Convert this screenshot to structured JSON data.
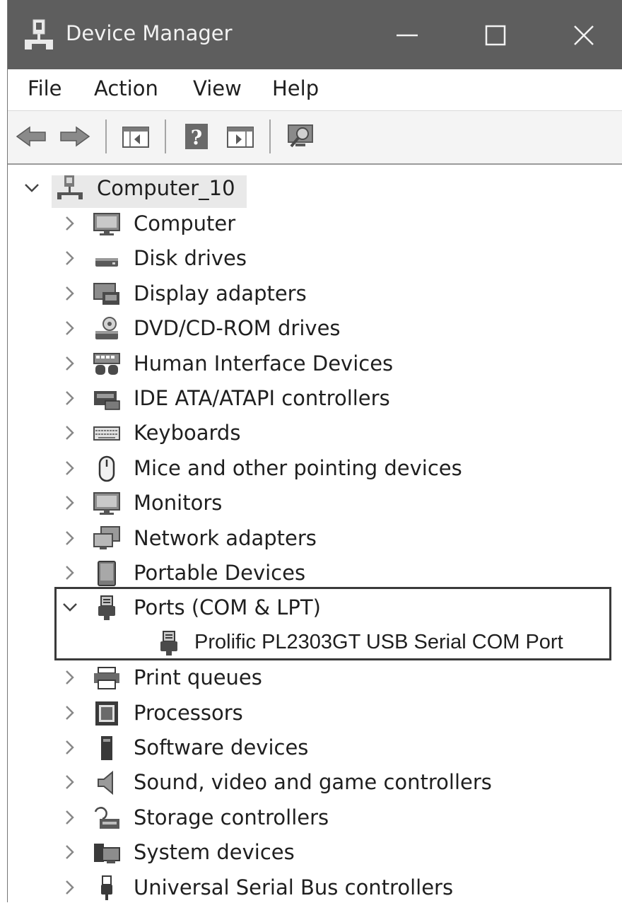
{
  "window": {
    "title": "Device Manager",
    "controls": {
      "minimize": "—",
      "maximize": "☐",
      "close": "✕"
    }
  },
  "menu": [
    "File",
    "Action",
    "View",
    "Help"
  ],
  "toolbar": {
    "buttons": [
      "back-arrow-icon",
      "forward-arrow-icon",
      "show-hide-console-tree-icon",
      "help-icon",
      "show-hide-action-pane-icon",
      "scan-hardware-changes-icon"
    ]
  },
  "tree": {
    "root": {
      "label": "Computer_10",
      "expanded": true,
      "icon": "computer-network-icon"
    },
    "categories": [
      {
        "label": "Computer",
        "icon": "monitor-icon"
      },
      {
        "label": "Disk drives",
        "icon": "disk-drive-icon"
      },
      {
        "label": "Display adapters",
        "icon": "display-adapter-icon"
      },
      {
        "label": "DVD/CD-ROM drives",
        "icon": "dvd-drive-icon"
      },
      {
        "label": "Human Interface Devices",
        "icon": "hid-icon"
      },
      {
        "label": "IDE ATA/ATAPI controllers",
        "icon": "ide-controller-icon"
      },
      {
        "label": "Keyboards",
        "icon": "keyboard-icon"
      },
      {
        "label": "Mice and other pointing devices",
        "icon": "mouse-icon"
      },
      {
        "label": "Monitors",
        "icon": "monitor-icon"
      },
      {
        "label": "Network adapters",
        "icon": "network-adapter-icon"
      },
      {
        "label": "Portable Devices",
        "icon": "portable-device-icon"
      },
      {
        "label": "Ports (COM & LPT)",
        "icon": "port-icon",
        "expanded": true,
        "children": [
          {
            "label": "Prolific PL2303GT USB Serial COM Port",
            "icon": "port-icon"
          }
        ]
      },
      {
        "label": "Print queues",
        "icon": "printer-icon"
      },
      {
        "label": "Processors",
        "icon": "processor-icon"
      },
      {
        "label": "Software devices",
        "icon": "software-device-icon"
      },
      {
        "label": "Sound, video and game controllers",
        "icon": "speaker-icon"
      },
      {
        "label": "Storage controllers",
        "icon": "storage-controller-icon"
      },
      {
        "label": "System devices",
        "icon": "system-devices-icon"
      },
      {
        "label": "Universal Serial Bus controllers",
        "icon": "usb-icon"
      }
    ]
  }
}
